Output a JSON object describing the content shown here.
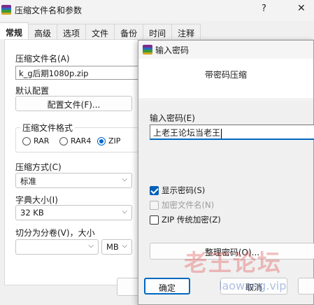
{
  "main_window": {
    "title": "压缩文件名和参数",
    "help_glyph": "?",
    "close_glyph": "✕",
    "tabs": [
      {
        "label": "常规",
        "active": true
      },
      {
        "label": "高级"
      },
      {
        "label": "选项"
      },
      {
        "label": "文件"
      },
      {
        "label": "备份"
      },
      {
        "label": "时间"
      },
      {
        "label": "注释"
      }
    ],
    "general": {
      "archive_name_label": "压缩文件名(A)",
      "archive_name_value": "k_g后期1080p.zip",
      "default_profile_label": "默认配置",
      "profiles_button": "配置文件(F)...",
      "format_group_label": "压缩文件格式",
      "formats": [
        {
          "label": "RAR",
          "checked": false
        },
        {
          "label": "RAR4",
          "checked": false
        },
        {
          "label": "ZIP",
          "checked": true
        }
      ],
      "method_label": "压缩方式(C)",
      "method_value": "标准",
      "dictionary_label": "字典大小(I)",
      "dictionary_value": "32 KB",
      "split_label": "切分为分卷(V)，大小",
      "split_value": "",
      "split_unit": "MB"
    }
  },
  "password_dialog": {
    "title": "输入密码",
    "header": "带密码压缩",
    "password_label": "输入密码(E)",
    "password_value": "上老王论坛当老王",
    "options": [
      {
        "label": "显示密码(S)",
        "checked": true,
        "disabled": false
      },
      {
        "label": "加密文件名(N)",
        "checked": false,
        "disabled": true
      },
      {
        "label": "ZIP 传统加密(Z)",
        "checked": false,
        "disabled": false
      }
    ],
    "manage_button": "整理密码(O)...",
    "ok_button": "确定",
    "cancel_button": "取消"
  },
  "watermark": {
    "text": "老王论坛",
    "url": "laowang.vip"
  },
  "colors": {
    "accent": "#0067c0",
    "watermark_red": "#de3c3c"
  }
}
